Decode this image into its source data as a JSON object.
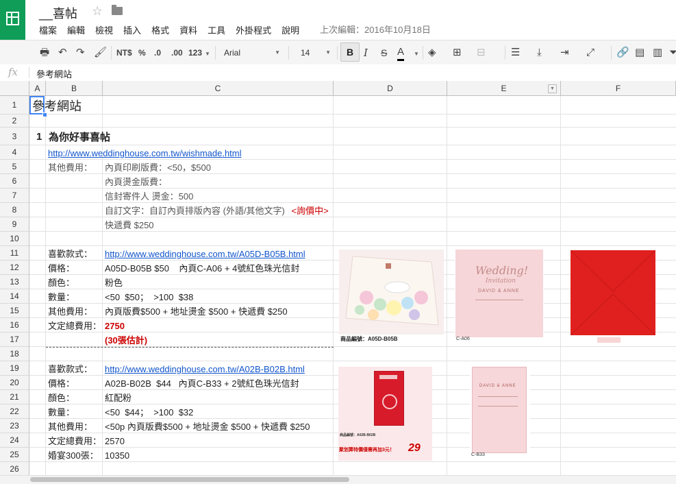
{
  "app": {
    "doc_title": "__喜帖",
    "menu": [
      "檔案",
      "編輯",
      "檢視",
      "插入",
      "格式",
      "資料",
      "工具",
      "外掛程式",
      "說明"
    ],
    "last_edit": "上次編輯：2016年10月18日"
  },
  "toolbar": {
    "currency": "NT$",
    "percent": "%",
    "dec_decrease": ".0",
    "dec_increase": ".00",
    "more_formats": "123",
    "font": "Arial",
    "size": "14",
    "bold": "B",
    "italic": "I",
    "strike": "S",
    "text_color": "A"
  },
  "formula_bar": {
    "fx": "fx",
    "content": "參考網站"
  },
  "columns": [
    "A",
    "B",
    "C",
    "D",
    "E",
    "F"
  ],
  "rows": [
    "1",
    "2",
    "3",
    "4",
    "5",
    "6",
    "7",
    "8",
    "9",
    "10",
    "11",
    "12",
    "13",
    "14",
    "15",
    "16",
    "17",
    "18",
    "19",
    "20",
    "21",
    "22",
    "23",
    "24",
    "25",
    "26"
  ],
  "sheet": {
    "r1_a": "參考網站",
    "r3_a": "1",
    "r3_b": "為你好事喜帖",
    "r4_b": "http://www.weddinghouse.com.tw/wishmade.html",
    "r5_b": "其他費用：",
    "r5_c": "內頁印刷版費：<50，$500",
    "r6_c": "內頁燙金版費：",
    "r7_c": "信封寄件人 燙金：500",
    "r8_c": "自訂文字：自訂內頁排版內容 (外語/其他文字)",
    "r8_c_red": "<詢價中>",
    "r9_c": "快遞費 $250",
    "r11_b": "喜歡款式：",
    "r11_c": "http://www.weddinghouse.com.tw/A05D-B05B.html",
    "r12_b": "價格：",
    "r12_c": "A05D-B05B $50    內頁C-A06 + 4號紅色珠光信封",
    "r13_b": "顏色：",
    "r13_c": "粉色",
    "r14_b": "數量：",
    "r14_c": "<50  $50；  >100  $38",
    "r15_b": "其他費用：",
    "r15_c": "內頁版費$500 + 地址燙金 $500 + 快遞費 $250",
    "r16_b": "文定總費用：",
    "r16_c": "2750",
    "r17_c": "(30張估計)",
    "r19_b": "喜歡款式：",
    "r19_c": "http://www.weddinghouse.com.tw/A02B-B02B.html",
    "r20_b": "價格：",
    "r20_c": "A02B-B02B  $44   內頁C-B33 + 2號紅色珠光信封",
    "r21_b": "顏色：",
    "r21_c": "紅配粉",
    "r22_b": "數量：",
    "r22_c": "<50  $44；  >100  $32",
    "r23_b": "其他費用：",
    "r23_c": "<50p 內頁版費$500 + 地址燙金 $500 + 快遞費 $250",
    "r24_b": "文定總費用：",
    "r24_c": "2570",
    "r25_b": "婚宴300張：",
    "r25_c": "10350"
  },
  "images": {
    "img1_caption": "商品編號：A05D-B05B",
    "img2_title": "Wedding!",
    "img2_sub": "Invitation",
    "img2_names": "DAVID & ANNE",
    "img2_caption": "C-A06",
    "img4_caption": "商品編號：A02B-B02B",
    "img4_promo": "聚划算特價僅需再加3元！",
    "img4_price": "29",
    "img5_names": "DAVID & ANNE",
    "img5_caption": "C-B33"
  },
  "colors": {
    "sheets_green": "#0f9d58",
    "link": "#1155cc",
    "red": "#cc0000",
    "envelope_red": "#e0201e"
  }
}
